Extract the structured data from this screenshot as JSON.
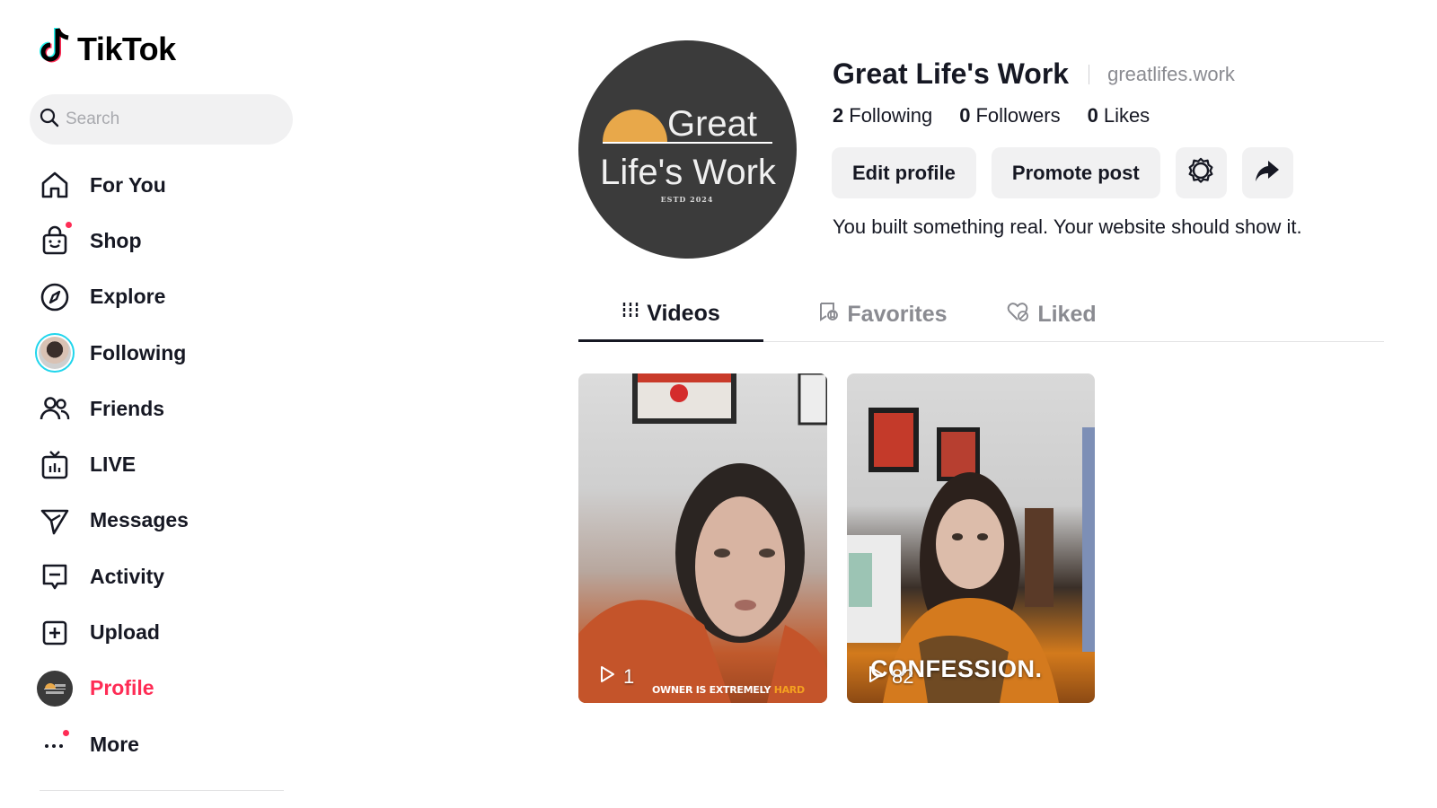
{
  "brand": {
    "name": "TikTok",
    "accent": "#fe2c55",
    "cyan": "#20d5ec"
  },
  "search": {
    "placeholder": "Search",
    "value": ""
  },
  "nav": {
    "items": [
      {
        "label": "For You",
        "icon": "home-icon"
      },
      {
        "label": "Shop",
        "icon": "shopping-bag-icon",
        "notification_dot": true
      },
      {
        "label": "Explore",
        "icon": "compass-icon"
      },
      {
        "label": "Following",
        "icon": "following-avatar"
      },
      {
        "label": "Friends",
        "icon": "friends-icon"
      },
      {
        "label": "LIVE",
        "icon": "live-tv-icon"
      },
      {
        "label": "Messages",
        "icon": "paper-plane-icon"
      },
      {
        "label": "Activity",
        "icon": "activity-icon"
      },
      {
        "label": "Upload",
        "icon": "plus-square-icon"
      },
      {
        "label": "Profile",
        "icon": "profile-avatar",
        "active": true
      },
      {
        "label": "More",
        "icon": "more-dots-icon",
        "notification_dot": true
      }
    ]
  },
  "profile": {
    "name": "Great Life's Work",
    "handle": "greatlifes.work",
    "avatar_text_1": "Great",
    "avatar_text_2": "Life's Work",
    "avatar_text_3": "ESTD 2024",
    "stats": {
      "following_count": "2",
      "following_label": "Following",
      "followers_count": "0",
      "followers_label": "Followers",
      "likes_count": "0",
      "likes_label": "Likes"
    },
    "buttons": {
      "edit": "Edit profile",
      "promote": "Promote post",
      "settings_icon": "gear-icon",
      "share_icon": "share-arrow-icon"
    },
    "bio": "You built something real. Your website should show it."
  },
  "tabs": [
    {
      "label": "Videos",
      "icon": "grid-icon",
      "active": true
    },
    {
      "label": "Favorites",
      "icon": "bookmark-icon",
      "active": false
    },
    {
      "label": "Liked",
      "icon": "heart-icon",
      "active": false
    }
  ],
  "videos": [
    {
      "plays": "1",
      "caption_pre": "OWNER IS EXTREMELY ",
      "caption_highlight": "HARD"
    },
    {
      "plays": "82",
      "caption_big": "CONFESSION."
    }
  ]
}
